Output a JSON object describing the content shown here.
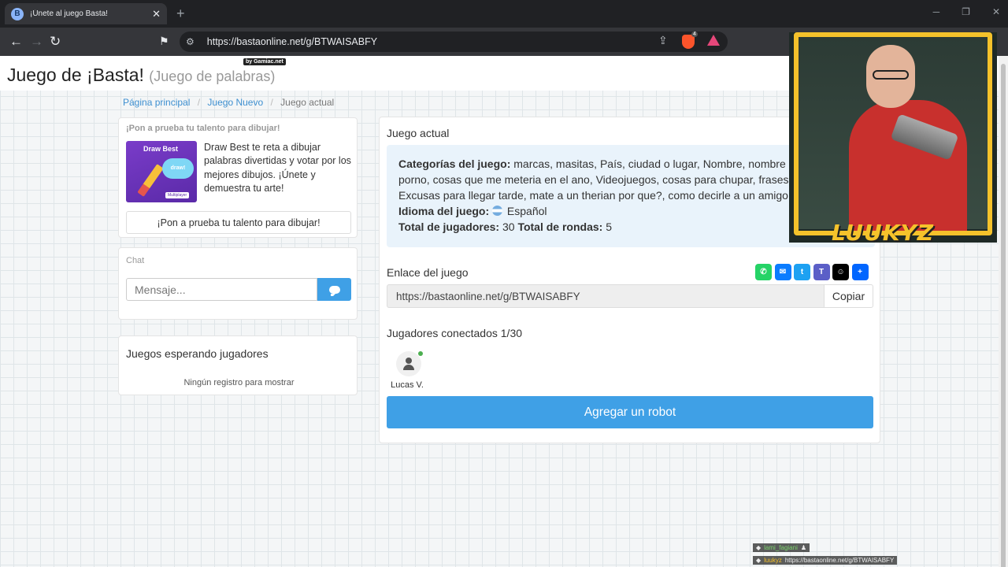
{
  "browser": {
    "tab_title": "¡Únete al juego Basta!",
    "tab_close": "✕",
    "new_tab": "+",
    "url": "https://bastaonline.net/g/BTWAISABFY",
    "brave_badge": "4"
  },
  "header": {
    "title": "Juego de ¡Basta!",
    "subtitle": "(Juego de palabras)",
    "badge": "by Gamiac.net"
  },
  "breadcrumb": {
    "home": "Página principal",
    "new_game": "Juego Nuevo",
    "current": "Juego actual"
  },
  "promo": {
    "title": "¡Pon a prueba tu talento para dibujar!",
    "image_title": "Draw Best",
    "image_cloud": "draw!",
    "image_logo": "Multiplayer",
    "text": "Draw Best te reta a dibujar palabras divertidas y votar por los mejores dibujos. ¡Únete y demuestra tu arte!",
    "button": "¡Pon a prueba tu talento para dibujar!"
  },
  "chat": {
    "title": "Chat",
    "placeholder": "Mensaje..."
  },
  "waiting": {
    "title": "Juegos esperando jugadores",
    "empty": "Ningún registro para mostrar"
  },
  "game": {
    "title": "Juego actual",
    "categories_label": "Categorías del juego:",
    "categories_line1": "marcas, masitas, País, ciudad o lugar, Nombre, nombre d",
    "categories_line2": "porno, cosas que me meteria en el ano, Videojuegos, cosas para chupar, frases",
    "categories_line3": "Excusas para llegar tarde, mate a un therian por que?, como decirle a un amigo",
    "language_label": "Idioma del juego:",
    "language": "Español",
    "players_label": "Total de jugadores:",
    "players_total": "30",
    "rounds_label": "Total de rondas:",
    "rounds_total": "5",
    "link_title": "Enlace del juego",
    "link_value": "https://bastaonline.net/g/BTWAISABFY",
    "copy_button": "Copiar",
    "connected": "Jugadores conectados 1/30",
    "player_name": "Lucas V.",
    "robot_button": "Agregar un robot"
  },
  "share": [
    {
      "name": "whatsapp",
      "glyph": "✆",
      "color": "#25d366"
    },
    {
      "name": "messenger",
      "glyph": "✉",
      "color": "#0a7cff"
    },
    {
      "name": "twitter",
      "glyph": "t",
      "color": "#1da1f2"
    },
    {
      "name": "teams",
      "glyph": "T",
      "color": "#5b5fc7"
    },
    {
      "name": "snapchat",
      "glyph": "☺",
      "color": "#000000"
    },
    {
      "name": "more",
      "glyph": "+",
      "color": "#0166ff"
    }
  ],
  "stream": {
    "streamer_name": "LUUKYZ",
    "chat_user1": "lami_fagiani",
    "chat_user2": "luukyz",
    "chat_msg2": "https://bastaonline.net/g/BTWAISABFY"
  }
}
